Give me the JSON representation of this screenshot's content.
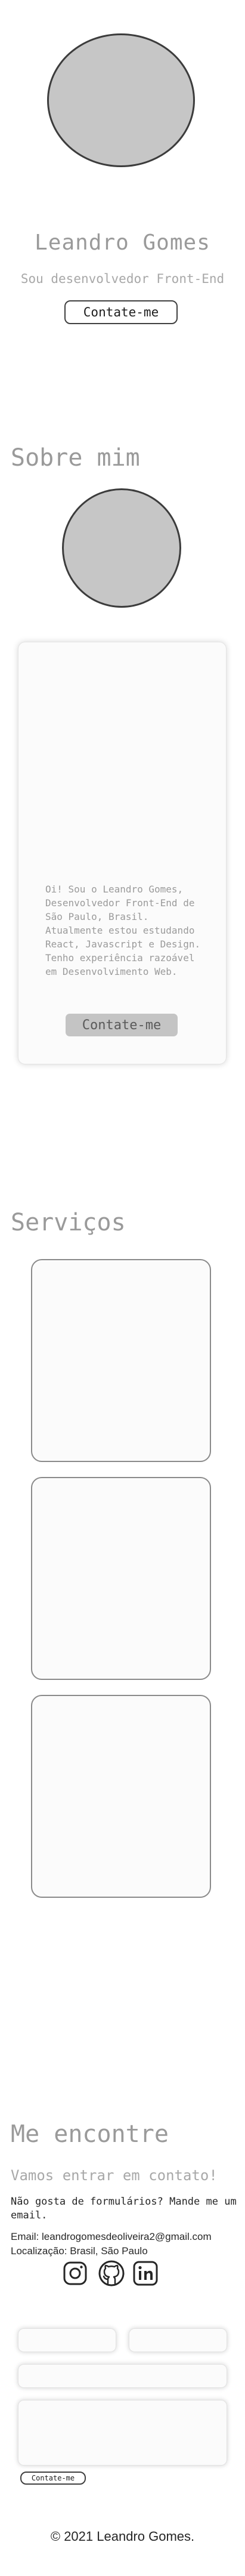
{
  "hero": {
    "name": "Leandro Gomes",
    "role": "Sou desenvolvedor Front-End",
    "cta_label": "Contate-me"
  },
  "about": {
    "title": "Sobre mim",
    "text": "Oi! Sou o Leandro Gomes, Desenvolvedor Front-End de São Paulo, Brasil. Atualmente estou estudando React, Javascript e Design. Tenho experiência razoável em Desenvolvimento Web.",
    "cta_label": "Contate-me"
  },
  "services": {
    "title": "Serviços"
  },
  "contact": {
    "title": "Me encontre",
    "subtitle": "Vamos entrar em contato!",
    "description": "Não gosta de formulários? Mande me um email.",
    "email_label": "Email:",
    "email_value": "leandrogomesdeoliveira2@gmail.com",
    "location_label": "Localização:",
    "location_value": "Brasil, São Paulo",
    "social": [
      "instagram-icon",
      "github-icon",
      "linkedin-icon"
    ],
    "send_label": "Contate-me"
  },
  "footer": {
    "text": "© 2021 Leandro Gomes."
  }
}
